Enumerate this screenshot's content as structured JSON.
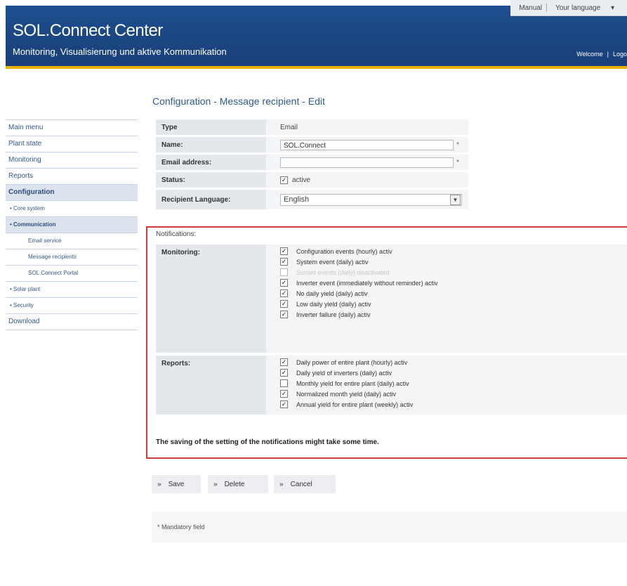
{
  "header": {
    "title": "SOL.Connect Center",
    "subtitle": "Monitoring, Visualisierung und aktive Kommunikation",
    "manual": "Manual",
    "language": "Your language",
    "welcome": "Welcome",
    "logout": "Logo"
  },
  "sidebar": {
    "items": [
      {
        "label": "Main menu"
      },
      {
        "label": "Plant state"
      },
      {
        "label": "Monitoring"
      },
      {
        "label": "Reports"
      },
      {
        "label": "Configuration"
      },
      {
        "label": "• Core system"
      },
      {
        "label": "• Communication"
      },
      {
        "label": "Email service"
      },
      {
        "label": "Message recipients"
      },
      {
        "label": "SOL.Connect Portal"
      },
      {
        "label": "• Solar plant"
      },
      {
        "label": "• Security"
      },
      {
        "label": "Download"
      }
    ]
  },
  "page": {
    "title": "Configuration - Message recipient - Edit"
  },
  "form": {
    "type_label": "Type",
    "type_value": "Email",
    "name_label": "Name:",
    "name_value": "SOL.Connect",
    "email_label": "Email address:",
    "email_value": "",
    "status_label": "Status:",
    "status_value": "active",
    "status_checked": true,
    "lang_label": "Recipient Language:",
    "lang_value": "English",
    "required_mark": "*"
  },
  "notifications": {
    "title": "Notifications:",
    "monitoring_label": "Monitoring:",
    "monitoring": [
      {
        "label": "Configuration events (hourly) activ",
        "checked": true,
        "disabled": false
      },
      {
        "label": "System event (daily) activ",
        "checked": true,
        "disabled": false
      },
      {
        "label": "Sunset events (daily) deactivated",
        "checked": false,
        "disabled": true
      },
      {
        "label": "Inverter event (immediately without reminder) activ",
        "checked": true,
        "disabled": false
      },
      {
        "label": "No daily yield (daily) activ",
        "checked": true,
        "disabled": false
      },
      {
        "label": "Low daily yield (daily) activ",
        "checked": true,
        "disabled": false
      },
      {
        "label": "Inverter failure (daily) activ",
        "checked": true,
        "disabled": false
      }
    ],
    "reports_label": "Reports:",
    "reports": [
      {
        "label": "Daily power of entire plant (hourly) activ",
        "checked": true
      },
      {
        "label": "Daily yield of inverters (daily) activ",
        "checked": true
      },
      {
        "label": "Monthly yield for entire plant (daily) activ",
        "checked": false
      },
      {
        "label": "Normalized month yield (daily) activ",
        "checked": true
      },
      {
        "label": "Annual yield for entire plant (weekly) activ",
        "checked": true
      }
    ],
    "saving_note": "The saving of the setting of the notifications might take some time."
  },
  "buttons": {
    "save": "Save",
    "delete": "Delete",
    "cancel": "Cancel",
    "raquo": "»"
  },
  "footer": {
    "mandatory": "* Mandatory field"
  },
  "colors": {
    "header": "#1d4f8f",
    "accent": "#e8b400",
    "highlight_border": "#d33b3b"
  }
}
